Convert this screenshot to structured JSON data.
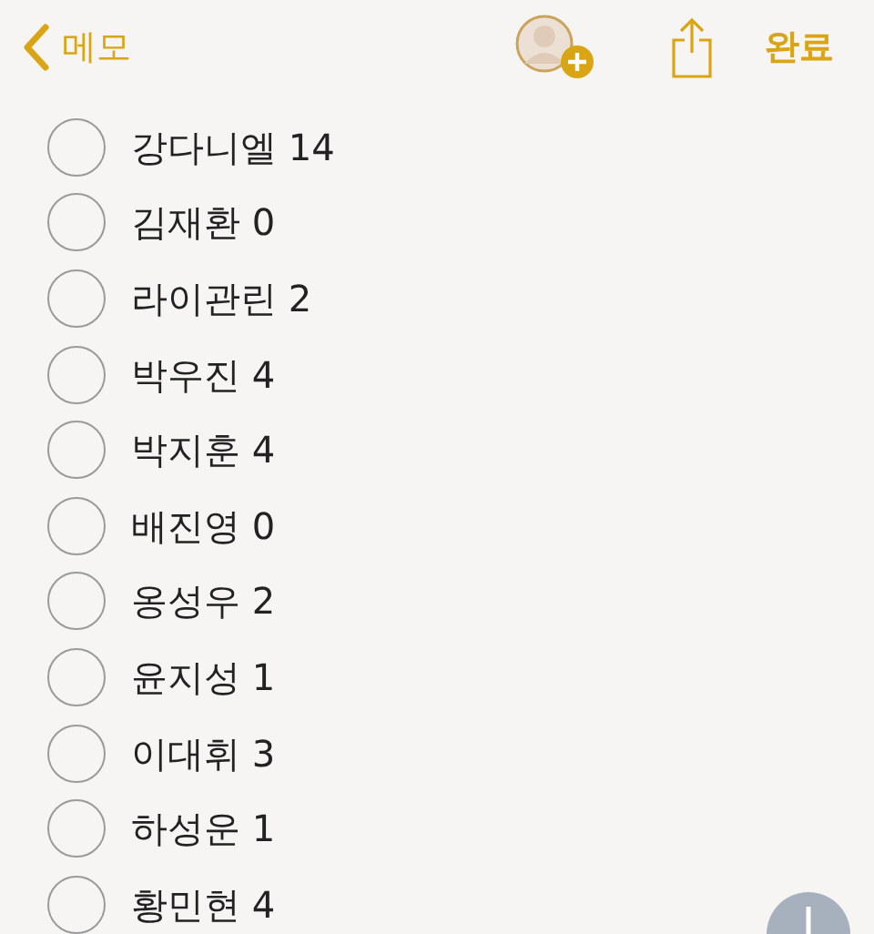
{
  "nav": {
    "back_label": "메모",
    "done_label": "완료"
  },
  "checklist": [
    {
      "text": "강다니엘 14",
      "checked": false
    },
    {
      "text": "김재환 0",
      "checked": false
    },
    {
      "text": "라이관린 2",
      "checked": false
    },
    {
      "text": "박우진 4",
      "checked": false
    },
    {
      "text": "박지훈 4",
      "checked": false
    },
    {
      "text": "배진영 0",
      "checked": false
    },
    {
      "text": "옹성우 2",
      "checked": false
    },
    {
      "text": "윤지성 1",
      "checked": false
    },
    {
      "text": "이대휘 3",
      "checked": false
    },
    {
      "text": "하성운 1",
      "checked": false
    },
    {
      "text": "황민현 4",
      "checked": false
    }
  ]
}
